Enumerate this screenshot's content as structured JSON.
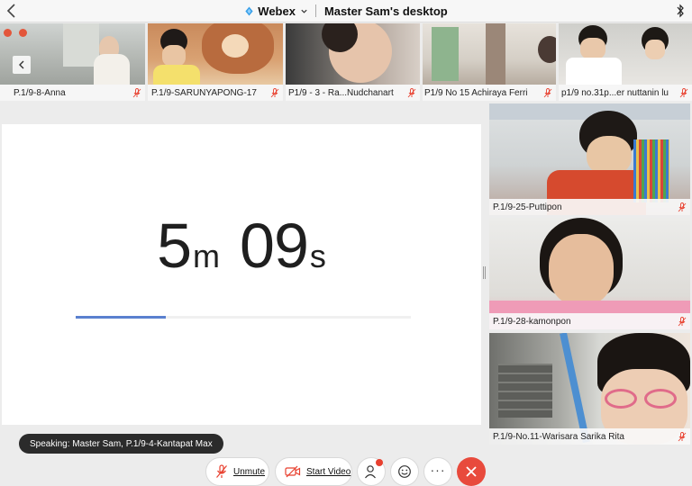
{
  "header": {
    "app_name": "Webex",
    "share_title": "Master Sam's desktop",
    "icons": [
      "back-chevron-icon",
      "webex-logo-icon",
      "chevron-down-icon",
      "bluetooth-icon"
    ]
  },
  "thumbnails": [
    {
      "name": "P.1/9-8-Anna"
    },
    {
      "name": "P.1/9-SARUNYAPONG-17"
    },
    {
      "name": "P1/9 - 3 - Ra...Nudchanart"
    },
    {
      "name": "P1/9 No 15 Achiraya Ferri"
    },
    {
      "name": "p1/9 no.31p...er nuttanin lu"
    }
  ],
  "shared_content": {
    "timer": {
      "minutes": "5",
      "minutes_unit": "m",
      "seconds": "09",
      "seconds_unit": "s"
    },
    "progress_fraction": 0.27,
    "progress_color": "#5a80cf"
  },
  "tiles": [
    {
      "name": "P.1/9-25-Puttipon"
    },
    {
      "name": "P.1/9-28-kamonpon"
    },
    {
      "name": "P.1/9-No.11-Warisara Sarika Rita"
    }
  ],
  "speaking_indicator": "Speaking: Master Sam, P.1/9-4-Kantapat Max",
  "toolbar": {
    "unmute_label": "Unmute",
    "start_video_label": "Start Video",
    "more_label": "···",
    "leave_color": "#e84a3c",
    "mute_color": "#e8402f"
  }
}
